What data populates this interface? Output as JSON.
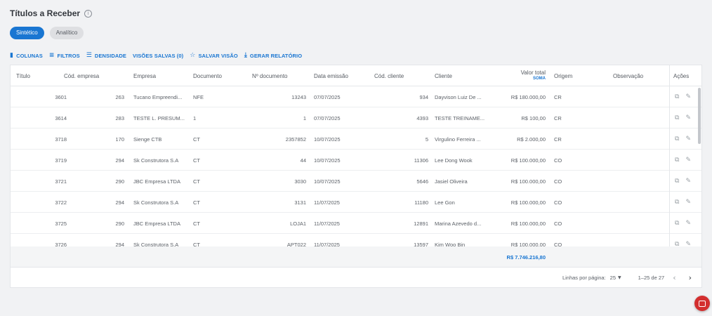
{
  "page": {
    "title": "Títulos a Receber",
    "info_icon": "i"
  },
  "view_toggle": {
    "sintetico": "Sintético",
    "analitico": "Analítico"
  },
  "toolbar": {
    "colunas": "COLUNAS",
    "filtros": "FILTROS",
    "densidade": "DENSIDADE",
    "visoes_salvas": "VISÕES SALVAS (0)",
    "salvar_visao": "SALVAR VISÃO",
    "gerar_relatorio": "GERAR RELATÓRIO",
    "icons": {
      "colunas": "columns-icon",
      "filtros": "filter-icon",
      "densidade": "density-icon",
      "salvar_visao": "star-icon",
      "gerar_relatorio": "download-icon"
    }
  },
  "columns": {
    "titulo": "Título",
    "cod_empresa": "Cód. empresa",
    "empresa": "Empresa",
    "documento": "Documento",
    "n_documento": "Nº documento",
    "data_emissao": "Data emissão",
    "cod_cliente": "Cód. cliente",
    "cliente": "Cliente",
    "valor_total": "Valor total",
    "valor_total_sub": "SOMA",
    "origem": "Origem",
    "observacao": "Observação",
    "acoes": "Ações"
  },
  "rows": [
    {
      "titulo": "3601",
      "cod_empresa": "263",
      "empresa": "Tucano Empreendi...",
      "documento": "NFE",
      "n_documento": "13243",
      "data_emissao": "07/07/2025",
      "cod_cliente": "934",
      "cliente": "Dayvison Luiz De ...",
      "valor_total": "R$ 180.000,00",
      "origem": "CR",
      "observacao": ""
    },
    {
      "titulo": "3614",
      "cod_empresa": "283",
      "empresa": "TESTE L. PRESUM...",
      "documento": "1",
      "n_documento": "1",
      "data_emissao": "07/07/2025",
      "cod_cliente": "4393",
      "cliente": "TESTE TREINAME...",
      "valor_total": "R$ 100,00",
      "origem": "CR",
      "observacao": ""
    },
    {
      "titulo": "3718",
      "cod_empresa": "170",
      "empresa": "Sienge CTB",
      "documento": "CT",
      "n_documento": "2357852",
      "data_emissao": "10/07/2025",
      "cod_cliente": "5",
      "cliente": "Virgulino Ferreira ...",
      "valor_total": "R$ 2.000,00",
      "origem": "CR",
      "observacao": ""
    },
    {
      "titulo": "3719",
      "cod_empresa": "294",
      "empresa": "Sk Construtora S.A",
      "documento": "CT",
      "n_documento": "44",
      "data_emissao": "10/07/2025",
      "cod_cliente": "11306",
      "cliente": "Lee Dong Wook",
      "valor_total": "R$ 100.000,00",
      "origem": "CO",
      "observacao": ""
    },
    {
      "titulo": "3721",
      "cod_empresa": "290",
      "empresa": "JBC Empresa LTDA",
      "documento": "CT",
      "n_documento": "3030",
      "data_emissao": "10/07/2025",
      "cod_cliente": "5646",
      "cliente": "Jasiel Oliveira",
      "valor_total": "R$ 100.000,00",
      "origem": "CO",
      "observacao": ""
    },
    {
      "titulo": "3722",
      "cod_empresa": "294",
      "empresa": "Sk Construtora S.A",
      "documento": "CT",
      "n_documento": "3131",
      "data_emissao": "11/07/2025",
      "cod_cliente": "11180",
      "cliente": "Lee Gon",
      "valor_total": "R$ 100.000,00",
      "origem": "CO",
      "observacao": ""
    },
    {
      "titulo": "3725",
      "cod_empresa": "290",
      "empresa": "JBC Empresa LTDA",
      "documento": "CT",
      "n_documento": "LOJA1",
      "data_emissao": "11/07/2025",
      "cod_cliente": "12891",
      "cliente": "Marina Azevedo d...",
      "valor_total": "R$ 100.000,00",
      "origem": "CO",
      "observacao": ""
    },
    {
      "titulo": "3726",
      "cod_empresa": "294",
      "empresa": "Sk Construtora S.A",
      "documento": "CT",
      "n_documento": "APT022",
      "data_emissao": "11/07/2025",
      "cod_cliente": "13597",
      "cliente": "Kim Woo Bin",
      "valor_total": "R$ 100.000,00",
      "origem": "CO",
      "observacao": ""
    }
  ],
  "totals": {
    "valor_total": "R$ 7.746.216,80"
  },
  "footer": {
    "rows_per_page_label": "Linhas por página:",
    "rows_per_page_value": "25",
    "range": "1–25 de 27"
  },
  "row_action_icons": [
    "copy-icon",
    "edit-pencil-icon"
  ],
  "colors": {
    "accent": "#1976d2",
    "chat_button": "#d32f2f"
  }
}
